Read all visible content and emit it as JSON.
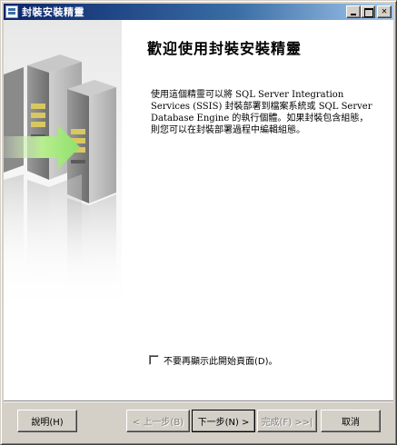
{
  "window": {
    "title": "封裝安裝精靈"
  },
  "main": {
    "heading": "歡迎使用封裝安裝精靈",
    "description": "使用這個精靈可以將 SQL Server Integration Services (SSIS) 封裝部署到檔案系統或 SQL Server Database Engine 的執行個體。如果封裝包含組態，則您可以在封裝部署過程中編輯組態。",
    "checkbox_label": "不要再顯示此開始頁面(D)。",
    "checkbox_checked": false
  },
  "buttons": {
    "help": "說明(H)",
    "back": "< 上一步(B)",
    "next": "下一步(N) >",
    "finish": "完成(F) >>|",
    "cancel": "取消"
  },
  "colors": {
    "titlebar_start": "#0a246a",
    "titlebar_end": "#a6caf0",
    "face": "#d4d0c8",
    "arrow": "#8fe06a"
  },
  "icons": {
    "window": "package-icon",
    "illustration": "server-deploy-arrow-icon"
  }
}
